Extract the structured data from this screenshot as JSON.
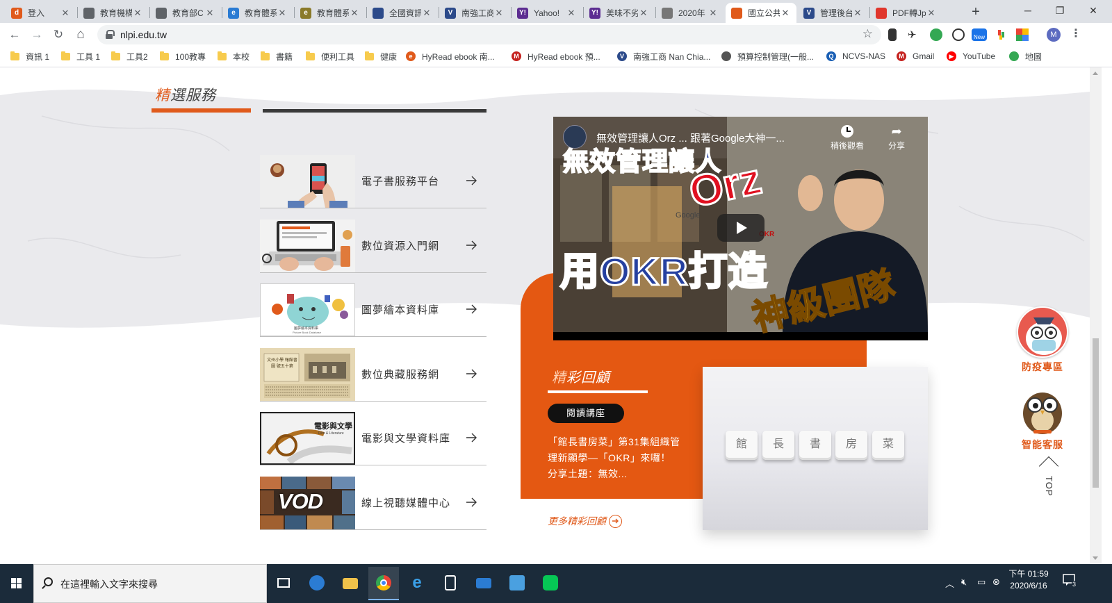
{
  "tabs": [
    {
      "title": "登入",
      "favicon_color": "#e05a1b",
      "favicon_text": "d"
    },
    {
      "title": "教育機構",
      "favicon_color": "#5f6368",
      "favicon_text": ""
    },
    {
      "title": "教育部C",
      "favicon_color": "#5f6368",
      "favicon_text": ""
    },
    {
      "title": "教育體系",
      "favicon_color": "#2a7bd3",
      "favicon_text": "e"
    },
    {
      "title": "教育體系",
      "favicon_color": "#8a7a2a",
      "favicon_text": "e"
    },
    {
      "title": "全國資訊",
      "favicon_color": "#2c4a8a",
      "favicon_text": ""
    },
    {
      "title": "南強工商",
      "favicon_color": "#2c4a8a",
      "favicon_text": "V"
    },
    {
      "title": "Yahoo!",
      "favicon_color": "#5c2d91",
      "favicon_text": "Y!"
    },
    {
      "title": "美味不劣",
      "favicon_color": "#5c2d91",
      "favicon_text": "Y!"
    },
    {
      "title": "2020年",
      "favicon_color": "#777777",
      "favicon_text": ""
    },
    {
      "title": "國立公共",
      "favicon_color": "#e05a1b",
      "favicon_text": ""
    },
    {
      "title": "管理後台",
      "favicon_color": "#2c4a8a",
      "favicon_text": "V"
    },
    {
      "title": "PDF轉Jp",
      "favicon_color": "#e0362c",
      "favicon_text": ""
    }
  ],
  "active_tab_index": 10,
  "window_controls": {
    "minimize": "─",
    "restore": "❐",
    "close": "✕"
  },
  "toolbar": {
    "back": "←",
    "forward": "→",
    "reload": "↻",
    "home": "⌂",
    "url": "nlpi.edu.tw",
    "bookmark_star": "☆",
    "profile_initial": "M",
    "menu": "⋮"
  },
  "bookmarks": [
    {
      "label": "資訊 1",
      "type": "folder"
    },
    {
      "label": "工具 1",
      "type": "folder"
    },
    {
      "label": "工具2",
      "type": "folder"
    },
    {
      "label": "100教專",
      "type": "folder"
    },
    {
      "label": "本校",
      "type": "folder"
    },
    {
      "label": "書籍",
      "type": "folder"
    },
    {
      "label": "便利工具",
      "type": "folder"
    },
    {
      "label": "健康",
      "type": "folder"
    },
    {
      "label": "HyRead ebook 南...",
      "type": "site",
      "icon_color": "#e05a1b",
      "icon_text": "e"
    },
    {
      "label": "HyRead ebook 預...",
      "type": "site",
      "icon_color": "#c5221f",
      "icon_text": "M"
    },
    {
      "label": "南強工商 Nan Chia...",
      "type": "site",
      "icon_color": "#2c4a8a",
      "icon_text": "V"
    },
    {
      "label": "預算控制管理(一般...",
      "type": "site",
      "icon_color": "#555555",
      "icon_text": ""
    },
    {
      "label": "NCVS-NAS",
      "type": "site",
      "icon_color": "#1a5fb4",
      "icon_text": "Q"
    },
    {
      "label": "Gmail",
      "type": "site",
      "icon_color": "#c5221f",
      "icon_text": "M"
    },
    {
      "label": "YouTube",
      "type": "site",
      "icon_color": "#ff0000",
      "icon_text": "▶"
    },
    {
      "label": "地圖",
      "type": "site",
      "icon_color": "#34a853",
      "icon_text": ""
    }
  ],
  "featured": {
    "heading_first_char": "精",
    "heading_rest": "選服務",
    "services": [
      {
        "label": "電子書服務平台",
        "arrow": "→"
      },
      {
        "label": "數位資源入門網",
        "arrow": "→"
      },
      {
        "label": "圖夢繪本資料庫",
        "arrow": "→"
      },
      {
        "label": "數位典藏服務網",
        "arrow": "→"
      },
      {
        "label": "電影與文學資料庫",
        "arrow": "→"
      },
      {
        "label": "線上視聽媒體中心",
        "arrow": "→"
      }
    ],
    "thumb_texts": {
      "picturebook_caption": "圖夢繪本資料庫",
      "picturebook_caption_en": "Picture Book Database",
      "archive_text": "文州小學 報館書圖 號五十第",
      "film_text": "電影與文學",
      "film_sub": "Film & Literature",
      "vod_text": "VOD"
    }
  },
  "video": {
    "title": "無效管理讓人Orz ... 跟著Google大神一...",
    "watch_later_label": "稍後觀看",
    "share_label": "分享",
    "thumb_line1": "無效管理讓人",
    "thumb_orz": "Orz",
    "thumb_line2": "用OKR打造",
    "thumb_line3": "神級團隊",
    "thumb_google": "Google",
    "thumb_okr": "OKR"
  },
  "review": {
    "heading_first_char": "精",
    "heading_rest": "彩回顧",
    "badge": "閱讀講座",
    "text": "「館長書房菜」第31集組織管理新顯學—「OKR」來囉！　分享土題：無效...",
    "keys": [
      "館",
      "長",
      "書",
      "房",
      "菜"
    ],
    "more_link": "更多精彩回顧"
  },
  "floating": {
    "covid_label": "防疫專區",
    "chatbot_label": "智能客服",
    "top_label": "TOP"
  },
  "taskbar": {
    "search_placeholder": "在這裡輸入文字來搜尋",
    "apps": [
      "task-view",
      "edge",
      "file-explorer",
      "chrome",
      "ie",
      "calculator",
      "mail",
      "photos",
      "line"
    ],
    "clock_time": "下午 01:59",
    "clock_date": "2020/6/16",
    "notification_count": "3"
  },
  "colors": {
    "accent_orange": "#e05a1b",
    "card_orange": "#e45812",
    "dark_bar": "#3a3a3a",
    "taskbar": "#1b2b3a"
  }
}
